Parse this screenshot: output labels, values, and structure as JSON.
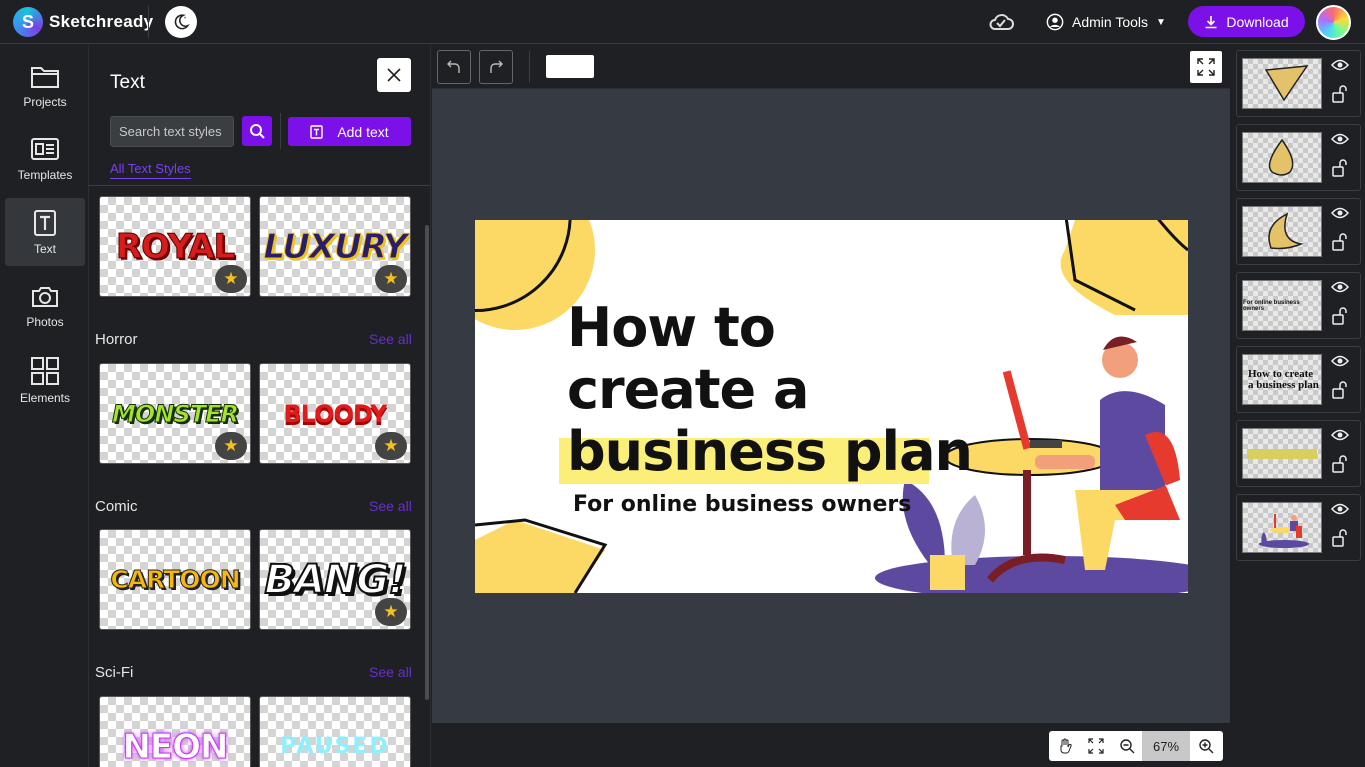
{
  "app": {
    "name": "Sketchready"
  },
  "header": {
    "admin_label": "Admin Tools",
    "download_label": "Download"
  },
  "rail": {
    "items": [
      {
        "label": "Projects",
        "icon": "folder-icon"
      },
      {
        "label": "Templates",
        "icon": "templates-icon"
      },
      {
        "label": "Text",
        "icon": "text-icon",
        "active": true
      },
      {
        "label": "Photos",
        "icon": "camera-icon"
      },
      {
        "label": "Elements",
        "icon": "elements-icon"
      }
    ]
  },
  "panel": {
    "title": "Text",
    "search_placeholder": "Search text styles",
    "add_text_label": "Add text",
    "all_styles_link": "All Text Styles",
    "see_all_label": "See all",
    "categories": [
      {
        "name": "",
        "tiles": [
          "ROYAL",
          "LUXURY"
        ]
      },
      {
        "name": "Horror",
        "tiles": [
          "MONSTER",
          "BLOODY"
        ]
      },
      {
        "name": "Comic",
        "tiles": [
          "CARTOON",
          "BANG!"
        ]
      },
      {
        "name": "Sci-Fi",
        "tiles": [
          "NEON",
          "PAUSED"
        ]
      }
    ]
  },
  "canvas": {
    "line1": "How to",
    "line2": "create a",
    "line3": "business plan",
    "subtitle": "For online business owners",
    "colors": {
      "yellow": "#fcd964",
      "purple": "#5d4aa0",
      "red": "#e63a2e",
      "dark": "#111111"
    }
  },
  "zoom": {
    "level": "67%"
  },
  "layers": {
    "items": [
      {
        "name": "yellow-shape-layer"
      },
      {
        "name": "yellow-drop-layer"
      },
      {
        "name": "yellow-moon-layer"
      },
      {
        "name": "subtitle-text-layer",
        "text": "For online business owners"
      },
      {
        "name": "title-text-layer",
        "text": "How to create a business plan"
      },
      {
        "name": "yellow-bar-layer"
      },
      {
        "name": "illustration-layer"
      }
    ]
  },
  "accent": "#7c10e8"
}
